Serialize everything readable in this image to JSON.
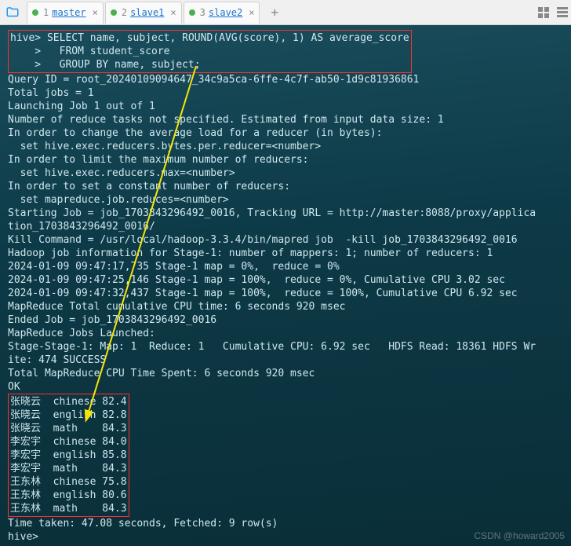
{
  "tabs": [
    {
      "num": "1",
      "name": "master"
    },
    {
      "num": "2",
      "name": "slave1"
    },
    {
      "num": "3",
      "name": "slave2"
    }
  ],
  "sql": {
    "prompt": "hive>",
    "cont": "    >",
    "line1": " SELECT name, subject, ROUND(AVG(score), 1) AS average_score",
    "line2": "   FROM student_score",
    "line3": "   GROUP BY name, subject;"
  },
  "log": [
    "Query ID = root_20240109094647_34c9a5ca-6ffe-4c7f-ab50-1d9c81936861",
    "Total jobs = 1",
    "Launching Job 1 out of 1",
    "Number of reduce tasks not specified. Estimated from input data size: 1",
    "In order to change the average load for a reducer (in bytes):",
    "  set hive.exec.reducers.bytes.per.reducer=<number>",
    "In order to limit the maximum number of reducers:",
    "  set hive.exec.reducers.max=<number>",
    "In order to set a constant number of reducers:",
    "  set mapreduce.job.reduces=<number>",
    "Starting Job = job_1703843296492_0016, Tracking URL = http://master:8088/proxy/applica",
    "tion_1703843296492_0016/",
    "Kill Command = /usr/local/hadoop-3.3.4/bin/mapred job  -kill job_1703843296492_0016",
    "Hadoop job information for Stage-1: number of mappers: 1; number of reducers: 1",
    "2024-01-09 09:47:17,735 Stage-1 map = 0%,  reduce = 0%",
    "2024-01-09 09:47:25,146 Stage-1 map = 100%,  reduce = 0%, Cumulative CPU 3.02 sec",
    "2024-01-09 09:47:32,437 Stage-1 map = 100%,  reduce = 100%, Cumulative CPU 6.92 sec",
    "MapReduce Total cumulative CPU time: 6 seconds 920 msec",
    "Ended Job = job_1703843296492_0016",
    "MapReduce Jobs Launched:",
    "Stage-Stage-1: Map: 1  Reduce: 1   Cumulative CPU: 6.92 sec   HDFS Read: 18361 HDFS Wr",
    "ite: 474 SUCCESS",
    "Total MapReduce CPU Time Spent: 6 seconds 920 msec",
    "OK"
  ],
  "results": [
    "张晓云  chinese 82.4",
    "张晓云  english 82.8",
    "张晓云  math    84.3",
    "李宏宇  chinese 84.0",
    "李宏宇  english 85.8",
    "李宏宇  math    84.3",
    "王东林  chinese 75.8",
    "王东林  english 80.6",
    "王东林  math    84.3"
  ],
  "footer": [
    "Time taken: 47.08 seconds, Fetched: 9 row(s)",
    "hive>"
  ],
  "watermark": "CSDN @howard2005",
  "chart_data": {
    "type": "table",
    "title": "Average score by name and subject",
    "columns": [
      "name",
      "subject",
      "average_score"
    ],
    "rows": [
      [
        "张晓云",
        "chinese",
        82.4
      ],
      [
        "张晓云",
        "english",
        82.8
      ],
      [
        "张晓云",
        "math",
        84.3
      ],
      [
        "李宏宇",
        "chinese",
        84.0
      ],
      [
        "李宏宇",
        "english",
        85.8
      ],
      [
        "李宏宇",
        "math",
        84.3
      ],
      [
        "王东林",
        "chinese",
        75.8
      ],
      [
        "王东林",
        "english",
        80.6
      ],
      [
        "王东林",
        "math",
        84.3
      ]
    ]
  }
}
